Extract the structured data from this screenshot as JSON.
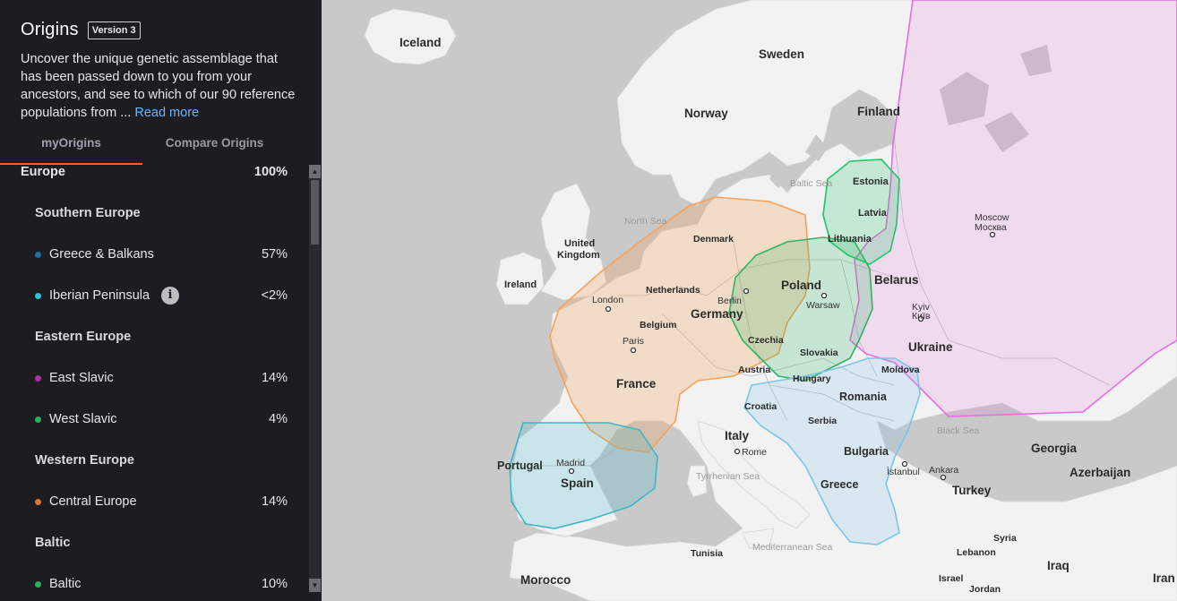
{
  "header": {
    "title": "Origins",
    "version": "Version 3"
  },
  "description": {
    "text": "Uncover the unique genetic assemblage that has been passed down to you from your ancestors, and see to which of our 90 reference populations from ...",
    "read_more": "Read more"
  },
  "tabs": [
    {
      "label": "myOrigins"
    },
    {
      "label": "Compare Origins"
    }
  ],
  "origins": {
    "europe": {
      "label": "Europe",
      "value": "100%"
    },
    "southern": {
      "label": "Southern Europe"
    },
    "greece": {
      "label": "Greece & Balkans",
      "value": "57%",
      "color": "#1a6fa8"
    },
    "iberian": {
      "label": "Iberian Peninsula",
      "value": "<2%",
      "color": "#2bc2da"
    },
    "eastern": {
      "label": "Eastern Europe"
    },
    "eastslavic": {
      "label": "East Slavic",
      "value": "14%",
      "color": "#b22fa6"
    },
    "westslavic": {
      "label": "West Slavic",
      "value": "4%",
      "color": "#22b35a"
    },
    "western": {
      "label": "Western Europe"
    },
    "central": {
      "label": "Central Europe",
      "value": "14%",
      "color": "#e0772a"
    },
    "baltic_group": {
      "label": "Baltic"
    },
    "baltic": {
      "label": "Baltic",
      "value": "10%",
      "color": "#22b35a"
    }
  },
  "map": {
    "countries": {
      "iceland": "Iceland",
      "sweden": "Sweden",
      "norway": "Norway",
      "finland": "Finland",
      "estonia": "Estonia",
      "latvia": "Latvia",
      "lithuania": "Lithuania",
      "uk1": "United",
      "uk2": "Kingdom",
      "ireland": "Ireland",
      "denmark": "Denmark",
      "netherlands": "Netherlands",
      "belgium": "Belgium",
      "germany": "Germany",
      "poland": "Poland",
      "belarus": "Belarus",
      "czechia": "Czechia",
      "slovakia": "Slovakia",
      "ukraine": "Ukraine",
      "austria": "Austria",
      "hungary": "Hungary",
      "moldova": "Moldova",
      "france": "France",
      "romania": "Romania",
      "croatia": "Croatia",
      "serbia": "Serbia",
      "italy": "Italy",
      "bulgaria": "Bulgaria",
      "portugal": "Portugal",
      "spain": "Spain",
      "greece": "Greece",
      "turkey": "Turkey",
      "georgia": "Georgia",
      "azerbaijan": "Azerbaijan",
      "tunisia": "Tunisia",
      "morocco": "Morocco",
      "syria": "Syria",
      "lebanon": "Lebanon",
      "iraq": "Iraq",
      "israel": "Israel",
      "jordan": "Jordan",
      "iran": "Iran"
    },
    "cities": {
      "london": "London",
      "paris": "Paris",
      "berlin": "Berlin",
      "warsaw": "Warsaw",
      "moscow1": "Moscow",
      "moscow2": "Москва",
      "kyiv1": "Kyiv",
      "kyiv2": "Київ",
      "madrid": "Madrid",
      "rome": "Rome",
      "istanbul": "İstanbul",
      "ankara": "Ankara"
    },
    "seas": {
      "north": "North Sea",
      "baltic": "Baltic Sea",
      "black": "Black Sea",
      "tyrrhenian": "Tyrrhenian Sea",
      "mediterranean": "Mediterranean Sea"
    },
    "region_colors": {
      "central": "#f6a25a",
      "iberian": "#3cb7c8",
      "greece": "#7ec3e8",
      "westslavic": "#2fb463",
      "baltic": "#1fc46a",
      "eastslavic": "#e46ee0"
    }
  }
}
